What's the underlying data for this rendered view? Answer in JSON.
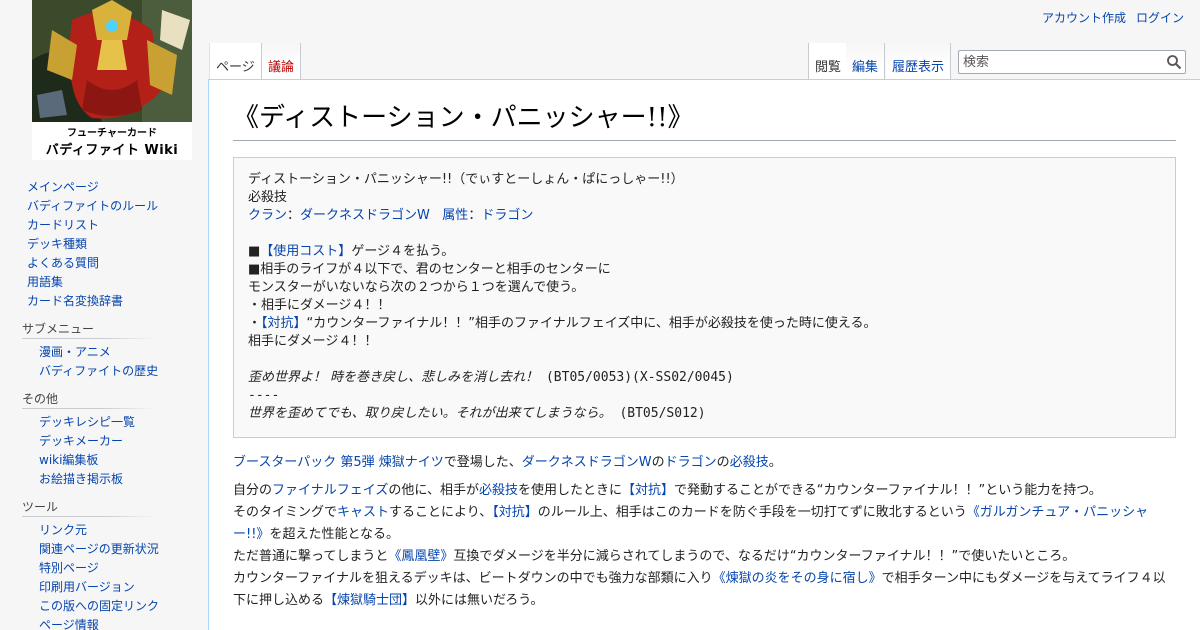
{
  "logo": {
    "line1": "フューチャーカード",
    "line2": "バディファイト Wiki"
  },
  "personal": [
    "アカウント作成",
    "ログイン"
  ],
  "tabs_left": {
    "page": "ページ",
    "talk": "議論"
  },
  "tabs_right": {
    "read": "閲覧",
    "edit": "編集",
    "history": "履歴表示"
  },
  "search": {
    "placeholder": "検索"
  },
  "sidebar": {
    "main_items": [
      "メインページ",
      "バディファイトのルール",
      "カードリスト",
      "デッキ種類",
      "よくある質問",
      "用語集",
      "カード名変換辞書"
    ],
    "submenu": {
      "title": "サブメニュー",
      "items": [
        "漫画・アニメ",
        "バディファイトの歴史"
      ]
    },
    "other": {
      "title": "その他",
      "items": [
        "デッキレシピ一覧",
        "デッキメーカー",
        "wiki編集板",
        "お絵描き掲示板"
      ]
    },
    "tools": {
      "title": "ツール",
      "items": [
        "リンク元",
        "関連ページの更新状況",
        "特別ページ",
        "印刷用バージョン",
        "この版への固定リンク",
        "ページ情報"
      ]
    }
  },
  "page": {
    "title": "《ディストーション・パニッシャー!!》",
    "card": {
      "name_line": "ディストーション・パニッシャー!!（でぃすとーしょん・ぱにっしゃー!!）",
      "type": "必殺技",
      "clan_label": "クラン",
      "colon1": "：",
      "clan_value": "ダークネスドラゴンW",
      "attr_label": "属性",
      "colon2": "：",
      "attr_value": "ドラゴン",
      "cost_prefix": "■",
      "cost_link": "【使用コスト】",
      "cost_text": "ゲージ４を払う。",
      "effect_line1": "■相手のライフが４以下で、君のセンターと相手のセンターに",
      "effect_line2": "モンスターがいないなら次の２つから１つを選んで使う。",
      "effect_line3": "・相手にダメージ４！！",
      "counter_prefix": "・",
      "counter_link": "【対抗】",
      "counter_text": "“カウンターファイナル！！”相手のファイナルフェイズ中に、相手が必殺技を使った時に使える。",
      "effect_line5": "相手にダメージ４！！",
      "flavor1_text": "歪め世界よ！ 時を巻き戻し、悲しみを消し去れ！",
      "flavor1_code": " (BT05/0053)(X-SS02/0045)",
      "separator": "----",
      "flavor2_text": "世界を歪めてでも、取り戻したい。それが出来てしまうなら。",
      "flavor2_code": " (BT05/S012)"
    },
    "p1": {
      "link1": "ブースターパック 第5弾 煉獄ナイツ",
      "t1": "で登場した、",
      "link2": "ダークネスドラゴンW",
      "t2": "の",
      "link3": "ドラゴン",
      "t3": "の",
      "link4": "必殺技",
      "t4": "。"
    },
    "p2": {
      "a1": "自分の",
      "a1_link": "ファイナルフェイズ",
      "a2": "の他に、相手が",
      "a2_link": "必殺技",
      "a3": "を使用したときに",
      "a3_link": "【対抗】",
      "a4": "で発動することができる“カウンターファイナル！！”という能力を持つ。",
      "b1": "そのタイミングで",
      "b1_link": "キャスト",
      "b2": "することにより、",
      "b2_link": "【対抗】",
      "b3": "のルール上、相手はこのカードを防ぐ手段を一切打てずに敗北するという",
      "b3_link": "《ガルガンチュア・パニッシャー!!》",
      "b4": "を超えた性能となる。",
      "c1": "ただ普通に撃ってしまうと",
      "c1_link": "《鳳凰壁》",
      "c2": "互換でダメージを半分に減らされてしまうので、なるだけ“カウンターファイナル！！”で使いたいところ。",
      "d1": "カウンターファイナルを狙えるデッキは、ビートダウンの中でも強力な部類に入り",
      "d1_link": "《煉獄の炎をその身に宿し》",
      "d2": "で相手ターン中にもダメージを与えてライフ４以下に押し込める",
      "d2_link": "【煉獄騎士団】",
      "d3": "以外には無いだろう。"
    }
  }
}
